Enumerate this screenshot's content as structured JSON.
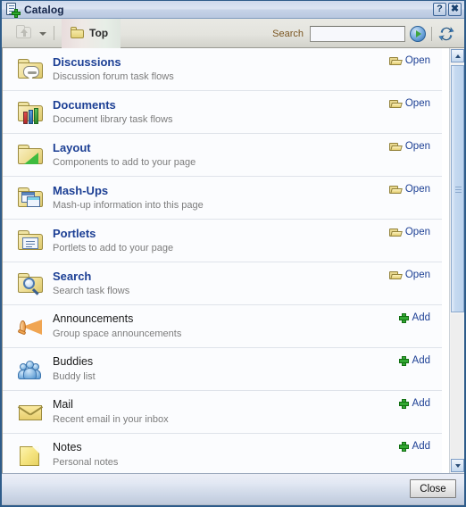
{
  "window": {
    "title": "Catalog",
    "title_icon": "catalog-add-icon",
    "help_button": "?",
    "close_button": "✖"
  },
  "toolbar": {
    "up_icon": "folder-up-icon",
    "dropdown_icon": "chevron-down-icon",
    "breadcrumb": {
      "icon": "folder-icon",
      "label": "Top"
    },
    "search_label": "Search",
    "search_value": "",
    "search_placeholder": "",
    "go_icon": "go-arrow-icon",
    "refresh_icon": "refresh-icon"
  },
  "list": {
    "items": [
      {
        "icon": "folder-discussions-icon",
        "title": "Discussions",
        "description": "Discussion forum task flows",
        "action_label": "Open",
        "action_icon": "open-folder-icon",
        "is_link": true
      },
      {
        "icon": "folder-documents-icon",
        "title": "Documents",
        "description": "Document library task flows",
        "action_label": "Open",
        "action_icon": "open-folder-icon",
        "is_link": true
      },
      {
        "icon": "folder-layout-icon",
        "title": "Layout",
        "description": "Components to add to your page",
        "action_label": "Open",
        "action_icon": "open-folder-icon",
        "is_link": true
      },
      {
        "icon": "folder-mashups-icon",
        "title": "Mash-Ups",
        "description": "Mash-up information into this page",
        "action_label": "Open",
        "action_icon": "open-folder-icon",
        "is_link": true
      },
      {
        "icon": "folder-portlets-icon",
        "title": "Portlets",
        "description": "Portlets to add to your page",
        "action_label": "Open",
        "action_icon": "open-folder-icon",
        "is_link": true
      },
      {
        "icon": "folder-search-icon",
        "title": "Search",
        "description": "Search task flows",
        "action_label": "Open",
        "action_icon": "open-folder-icon",
        "is_link": true
      },
      {
        "icon": "megaphone-icon",
        "title": "Announcements",
        "description": "Group space announcements",
        "action_label": "Add",
        "action_icon": "plus-icon",
        "is_link": false
      },
      {
        "icon": "buddies-icon",
        "title": "Buddies",
        "description": "Buddy list",
        "action_label": "Add",
        "action_icon": "plus-icon",
        "is_link": false
      },
      {
        "icon": "mail-envelope-icon",
        "title": "Mail",
        "description": "Recent email in your inbox",
        "action_label": "Add",
        "action_icon": "plus-icon",
        "is_link": false
      },
      {
        "icon": "note-icon",
        "title": "Notes",
        "description": "Personal notes",
        "action_label": "Add",
        "action_icon": "plus-icon",
        "is_link": false
      }
    ]
  },
  "scrollbar": {
    "up_arrow": "chevron-up-icon",
    "down_arrow": "chevron-down-icon"
  },
  "footer": {
    "close_label": "Close"
  },
  "colors": {
    "link": "#1c3f94",
    "title_bar": "#dbe4f2",
    "toolbar": "#e4e4de",
    "row_bg": "#fbfcfe",
    "description": "#7c7c7c",
    "search_label": "#7a5520",
    "window_border": "#2e5c8a"
  }
}
